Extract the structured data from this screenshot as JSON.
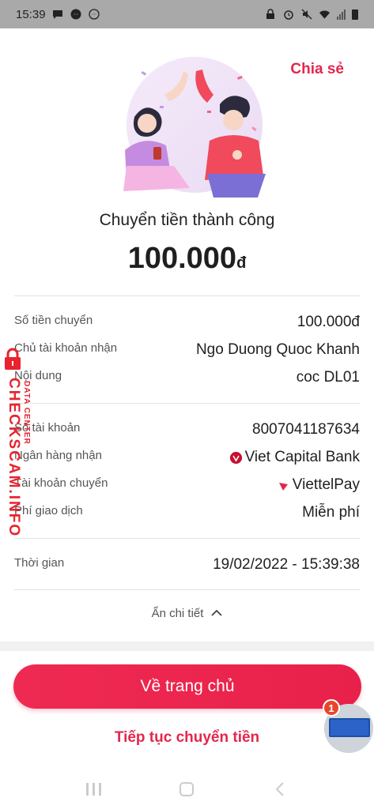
{
  "status_bar": {
    "time": "15:39",
    "left_icons": [
      "message-icon",
      "messenger-icon",
      "messenger-icon"
    ],
    "right_icons": [
      "lock-icon",
      "alarm-icon",
      "mute-icon",
      "wifi-icon",
      "signal-icon",
      "battery-icon"
    ]
  },
  "header": {
    "share_label": "Chia sẻ"
  },
  "result": {
    "title": "Chuyển tiền thành công",
    "amount": "100.000",
    "currency": "đ"
  },
  "details_group1": [
    {
      "label": "Số tiền chuyển",
      "value": "100.000đ"
    },
    {
      "label": "Chủ tài khoản nhận",
      "value": "Ngo Duong Quoc Khanh"
    },
    {
      "label": "Nội dung",
      "value": "coc DL01"
    }
  ],
  "details_group2": [
    {
      "label": "Số tài khoản",
      "value": "8007041187634"
    },
    {
      "label": "Ngân hàng nhận",
      "value": "Viet Capital Bank",
      "icon": "viet-capital-bank-logo-icon"
    },
    {
      "label": "Tài khoản chuyển",
      "value": "ViettelPay",
      "icon": "viettelpay-logo-icon"
    },
    {
      "label": "Phí giao dịch",
      "value": "Miễn phí"
    }
  ],
  "details_group3": [
    {
      "label": "Thời gian",
      "value": "19/02/2022 - 15:39:38"
    }
  ],
  "toggle": {
    "label": "Ẩn chi tiết",
    "icon": "chevron-up-icon"
  },
  "actions": {
    "home_label": "Về trang chủ",
    "continue_label": "Tiếp tục chuyển tiền"
  },
  "chat_head": {
    "badge_count": "1"
  },
  "watermark": {
    "main": "CHECKSCAM.INFO",
    "sub": "DATA CENTER"
  },
  "colors": {
    "accent": "#e3274d",
    "button_gradient_start": "#ef2a52",
    "status_bar_bg": "#a9a9a9"
  }
}
